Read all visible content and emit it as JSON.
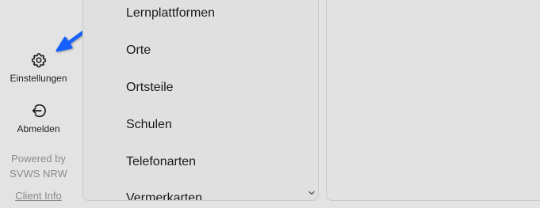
{
  "sidebar": {
    "settings": {
      "label": "Einstellungen",
      "icon": "gear-icon"
    },
    "logout": {
      "label": "Abmelden",
      "icon": "logout-icon"
    },
    "powered_line1": "Powered by",
    "powered_line2": "SVWS NRW",
    "client_info": "Client Info"
  },
  "list": {
    "items": [
      "Lernplattformen",
      "Orte",
      "Ortsteile",
      "Schulen",
      "Telefonarten",
      "Vermerkarten"
    ]
  },
  "annotation": {
    "arrow_color": "#1560ff"
  }
}
